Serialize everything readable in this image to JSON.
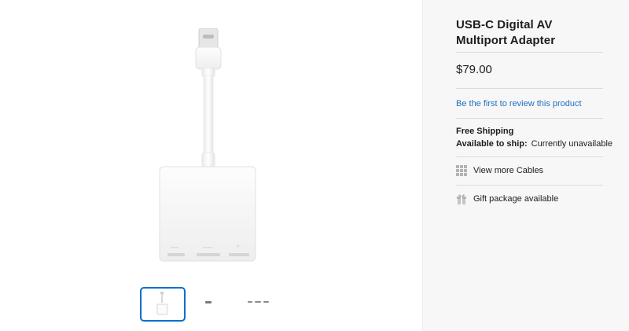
{
  "product": {
    "title_line1": "USB-C Digital AV",
    "title_line2": "Multiport Adapter",
    "price": "$79.00"
  },
  "review": {
    "link_label": "Be the first to review this product"
  },
  "shipping": {
    "title": "Free Shipping",
    "availability_label": "Available to ship:",
    "availability_value": "Currently unavailable"
  },
  "links": {
    "more_label": "View more Cables",
    "more_icon": "grid-icon",
    "gift_label": "Gift package available",
    "gift_icon": "gift-icon"
  },
  "gallery": {
    "thumbnails": [
      "front-view",
      "connector-view",
      "ports-view"
    ],
    "selected_index": 0
  },
  "colors": {
    "link": "#1f70c1",
    "selected": "#0070c9",
    "panel": "#f7f7f7"
  }
}
